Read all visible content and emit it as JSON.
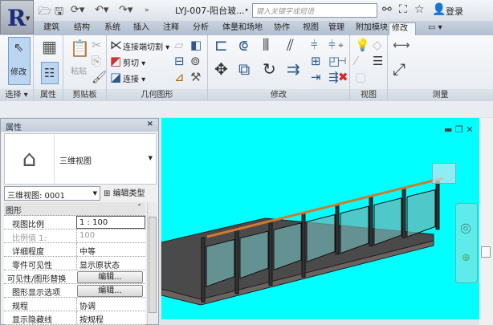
{
  "app": {
    "logo": "R",
    "title": "LYJ-007-阳台玻...",
    "search_placeholder": "键入关键字或短语",
    "login": "登录"
  },
  "qat": [
    "open-icon",
    "save-icon",
    "sync-icon",
    "undo-icon",
    "redo-icon",
    "more-icon"
  ],
  "tabs": [
    {
      "label": "建筑"
    },
    {
      "label": "结构"
    },
    {
      "label": "系统"
    },
    {
      "label": "插入"
    },
    {
      "label": "注释"
    },
    {
      "label": "分析"
    },
    {
      "label": "体量和场地"
    },
    {
      "label": "协作"
    },
    {
      "label": "视图"
    },
    {
      "label": "管理"
    },
    {
      "label": "附加模块"
    },
    {
      "label": "修改"
    },
    {
      "label": "▭ ▾"
    }
  ],
  "ribbon": {
    "select": {
      "button": "修改",
      "label": "选择 ▾"
    },
    "properties": {
      "label": "属性"
    },
    "clipboard": {
      "paste": "粘贴",
      "label": "剪贴板"
    },
    "geometry": {
      "cope": "连接端切割 ▾",
      "cut": "剪切 ▾",
      "join": "连接 ▾",
      "label": "几何图形"
    },
    "modify": {
      "label": "修改"
    },
    "view": {
      "label": "视图"
    },
    "measure": {
      "label": "测量"
    }
  },
  "properties": {
    "title": "属性",
    "close": "×",
    "type_name": "三维视图",
    "instance": "三维视图: 0001",
    "edit_type": "编辑类型",
    "group": "图形",
    "rows": [
      {
        "key": "视图比例",
        "value": "1 : 100"
      },
      {
        "key": "比例值 1:",
        "value": "100"
      },
      {
        "key": "详细程度",
        "value": "中等"
      },
      {
        "key": "零件可见性",
        "value": "显示原状态"
      },
      {
        "key": "可见性/图形替换",
        "value": "编辑..."
      },
      {
        "key": "图形显示选项",
        "value": "编辑..."
      },
      {
        "key": "规程",
        "value": "协调"
      },
      {
        "key": "显示隐藏线",
        "value": "按规程"
      }
    ]
  },
  "viewport": {
    "background": "#00ffff",
    "rail_color": "#d07a30",
    "glass_color": "#6fb0b0"
  }
}
